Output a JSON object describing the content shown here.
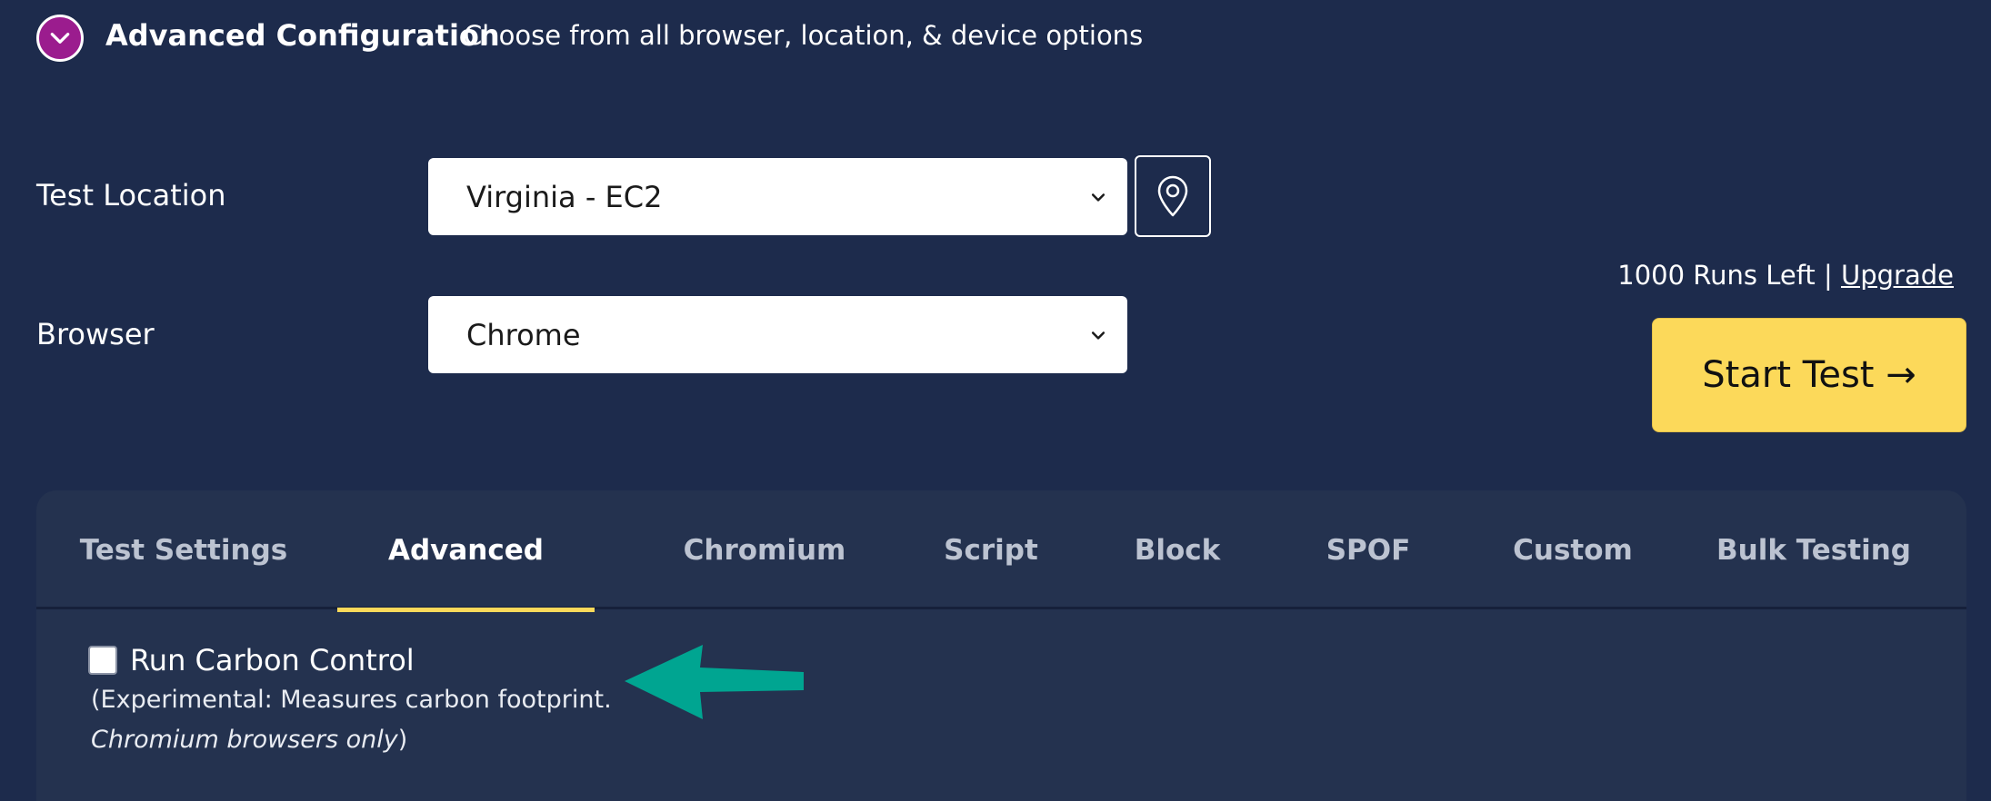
{
  "header": {
    "title": "Advanced Configuration",
    "subtitle": "Choose from all browser, location, & device options",
    "toggle_icon": "chevron-down-icon"
  },
  "form": {
    "location_label": "Test Location",
    "location_value": "Virginia - EC2",
    "location_icon": "map-pin-icon",
    "browser_label": "Browser",
    "browser_value": "Chrome"
  },
  "runs": {
    "text": "1000 Runs Left",
    "separator": "|",
    "upgrade": "Upgrade"
  },
  "start_button": "Start Test →",
  "tabs": [
    {
      "label": "Test Settings",
      "active": false
    },
    {
      "label": "Advanced",
      "active": true
    },
    {
      "label": "Chromium",
      "active": false
    },
    {
      "label": "Script",
      "active": false
    },
    {
      "label": "Block",
      "active": false
    },
    {
      "label": "SPOF",
      "active": false
    },
    {
      "label": "Custom",
      "active": false
    },
    {
      "label": "Bulk Testing",
      "active": false
    }
  ],
  "advanced": {
    "carbon_label": "Run Carbon Control",
    "carbon_checked": false,
    "note_line1": "(Experimental: Measures carbon footprint.",
    "note_line2_italic": "Chromium browsers only",
    "note_line2_close": ")"
  },
  "colors": {
    "background": "#1d2b4c",
    "panel": "#24324f",
    "accent_yellow": "#fcd95a",
    "toggle_purple": "#9b1c8e",
    "arrow_teal": "#00a591"
  }
}
